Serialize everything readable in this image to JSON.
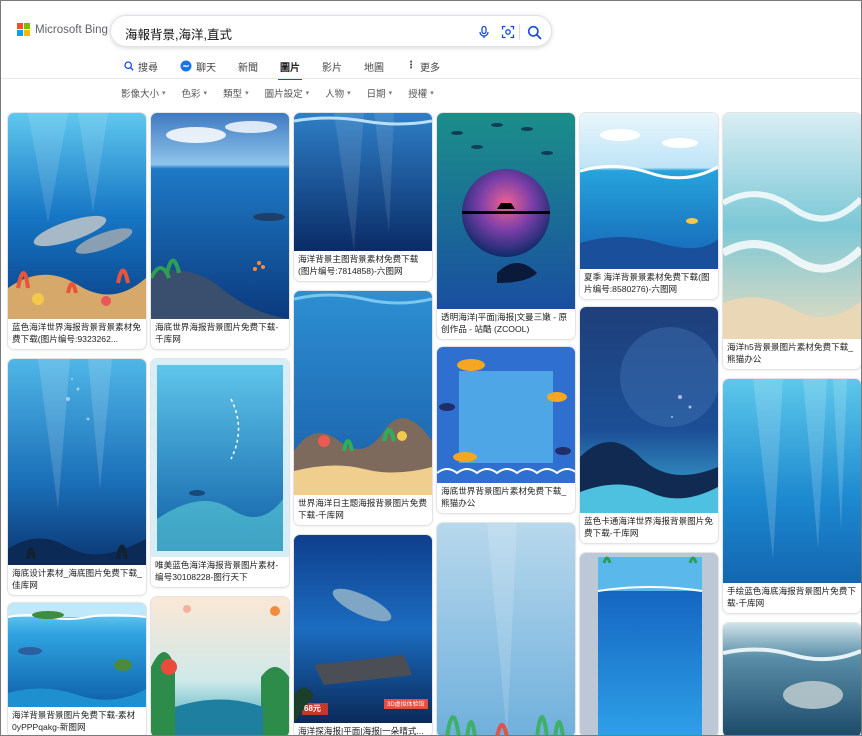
{
  "logo": {
    "text": "Microsoft Bing",
    "colors": [
      "#f25022",
      "#7fba00",
      "#00a4ef",
      "#ffb900"
    ]
  },
  "search": {
    "query": "海報背景,海洋,直式",
    "icons": [
      "mic-icon",
      "visual-search-icon",
      "search-icon"
    ]
  },
  "tabs": [
    {
      "label": "搜尋",
      "icon": "search-icon"
    },
    {
      "label": "聊天",
      "icon": "copilot-chat-icon"
    },
    {
      "label": "新聞",
      "icon": ""
    },
    {
      "label": "圖片",
      "icon": "",
      "active": true
    },
    {
      "label": "影片",
      "icon": ""
    },
    {
      "label": "地圖",
      "icon": ""
    },
    {
      "label": "更多",
      "icon": "more-icon"
    }
  ],
  "filters": [
    "影像大小",
    "色彩",
    "類型",
    "圖片設定",
    "人物",
    "日期",
    "授權"
  ],
  "accent": "#174ae4",
  "results": [
    {
      "caption": "蓝色海洋世界海报背景背景素材免费下载(图片编号:9323262..."
    },
    {
      "caption": "海底世界海报背景图片免费下载-千库网"
    },
    {
      "caption": "海洋背景主图背景素材免费下载(图片编号:7814858)-六图网"
    },
    {
      "caption": "透明海洋|平面|海报|文曼三嫩 - 原创作品 - 站酷 (ZCOOL)"
    },
    {
      "caption": "夏季 海洋背景景素材免费下载(图片编号:8580276)-六图网"
    },
    {
      "caption": "海洋h5背景景图片素材免费下载_熊猫办公"
    },
    {
      "caption": "海底设计素材_海底图片免费下载_佳库网"
    },
    {
      "caption": "唯美蓝色海洋海报背景图片素材-编号30108228-图行天下"
    },
    {
      "caption": "世界海洋日主题海报背景图片免费下载-千库网"
    },
    {
      "caption": "海底世界背景图片素材免费下载_熊猫办公"
    },
    {
      "caption": "蓝色卡通海洋世界海报背景图片免费下载-千库网"
    },
    {
      "caption": "手绘蓝色海底海报背景图片免费下载-千库网"
    },
    {
      "caption": "海洋背景背景图片免费下载-素材0yPPPqakg-新图网"
    },
    {
      "caption": ""
    },
    {
      "caption": "海洋探海报|平面|海报|一朵晴式..."
    },
    {
      "caption": ""
    },
    {
      "caption": ""
    },
    {
      "caption": ""
    }
  ],
  "thumb_text": {
    "poster_price": "68元",
    "poster_badge": "3D虚拟体验馆"
  }
}
